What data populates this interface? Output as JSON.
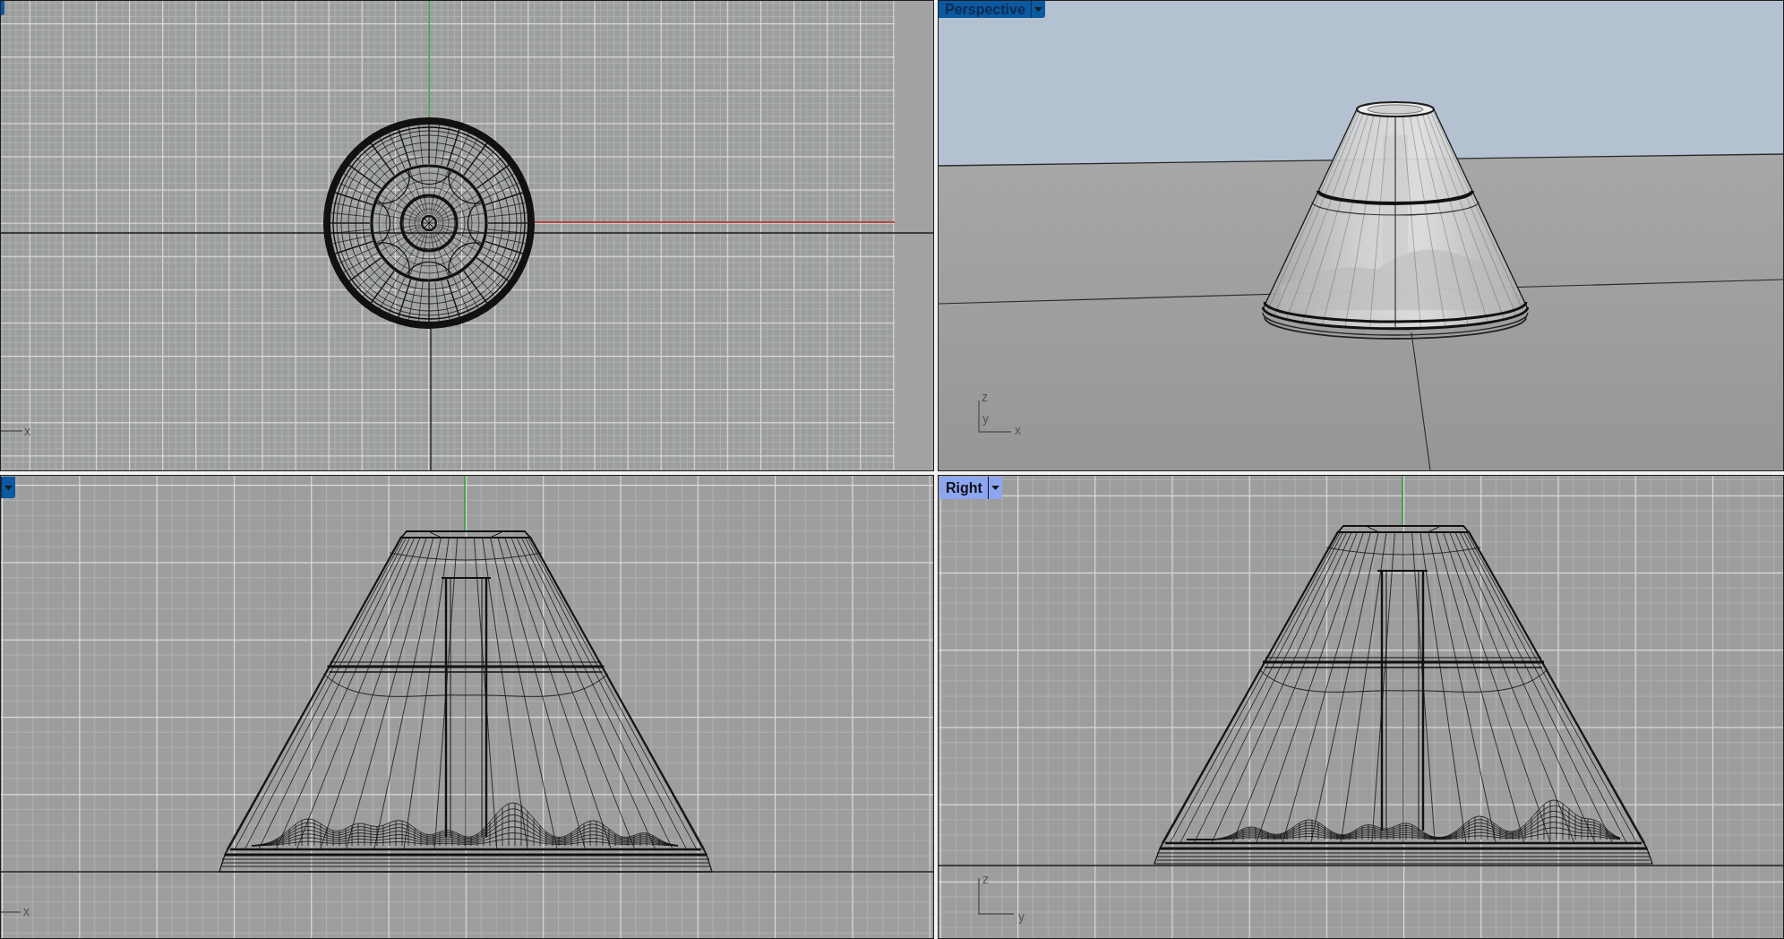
{
  "viewports": [
    {
      "kind": "top",
      "selected": false,
      "dropdown": false,
      "axis_labels": [
        "x"
      ]
    },
    {
      "kind": "perspective",
      "title": "Perspective",
      "selected": false,
      "dropdown": true,
      "axis_labels": [
        "z",
        "y",
        "x"
      ]
    },
    {
      "kind": "front",
      "selected": false,
      "dropdown": true,
      "axis_labels": [
        "x"
      ]
    },
    {
      "kind": "right",
      "title": "Right",
      "selected": true,
      "dropdown": true,
      "axis_labels": [
        "z",
        "y"
      ]
    }
  ]
}
